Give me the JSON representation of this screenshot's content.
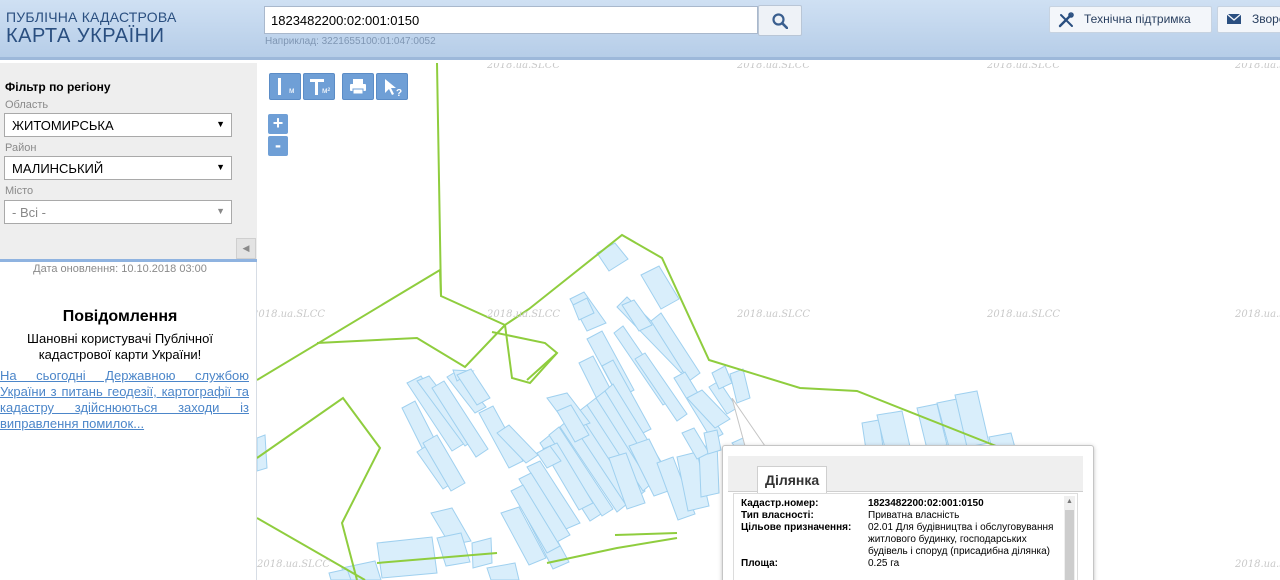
{
  "header": {
    "logo_line1": "ПУБЛІЧНА КАДАСТРОВА",
    "logo_line2": "КАРТА УКРАЇНИ",
    "search_value": "1823482200:02:001:0150",
    "search_icon": "search-icon",
    "example_text": "Наприклад: 3221655100:01:047:0052",
    "support_label": "Технічна підтримка",
    "support_icon": "tools-icon",
    "contact_label": "Зворотній зв'язок",
    "contact_icon": "envelope-icon"
  },
  "sidebar": {
    "filter_title": "Фільтр по регіону",
    "oblast_label": "Область",
    "oblast_value": "ЖИТОМИРСЬКА",
    "raion_label": "Район",
    "raion_value": "МАЛИНСЬКИЙ",
    "city_label": "Місто",
    "city_value": "- Всі -",
    "update_text": "Дата оновлення: 10.10.2018 03:00",
    "message_title": "Повідомлення",
    "message_text": "Шановні користувачі Публічної кадастрової карти України!",
    "message_link": "На сьогодні Державною службою України з питань геодезії, картографії та кадастру здійснюються заходи із виправлення помилок..."
  },
  "map": {
    "tools": {
      "ruler_label": "м",
      "area_label": "м²"
    },
    "zoom_in": "+",
    "zoom_out": "-",
    "watermark": "2018.ua.SLCC",
    "colors": {
      "boundary": "#8fcd3e",
      "parcel_fill": "#d9eefb",
      "parcel_stroke": "#9fd0ef",
      "tool": "#6f9fd6"
    }
  },
  "popup": {
    "tab": "Ділянка",
    "rows": [
      {
        "key": "Кадастр.номер:",
        "value": "1823482200:02:001:0150"
      },
      {
        "key": "Тип власності:",
        "value": "Приватна власність"
      },
      {
        "key": "Цільове призначення:",
        "value": "02.01 Для будівництва і обслуговування житлового будинку, господарських будівель і споруд (присадибна ділянка)"
      },
      {
        "key": "Площа:",
        "value": "0.25 га"
      }
    ]
  }
}
